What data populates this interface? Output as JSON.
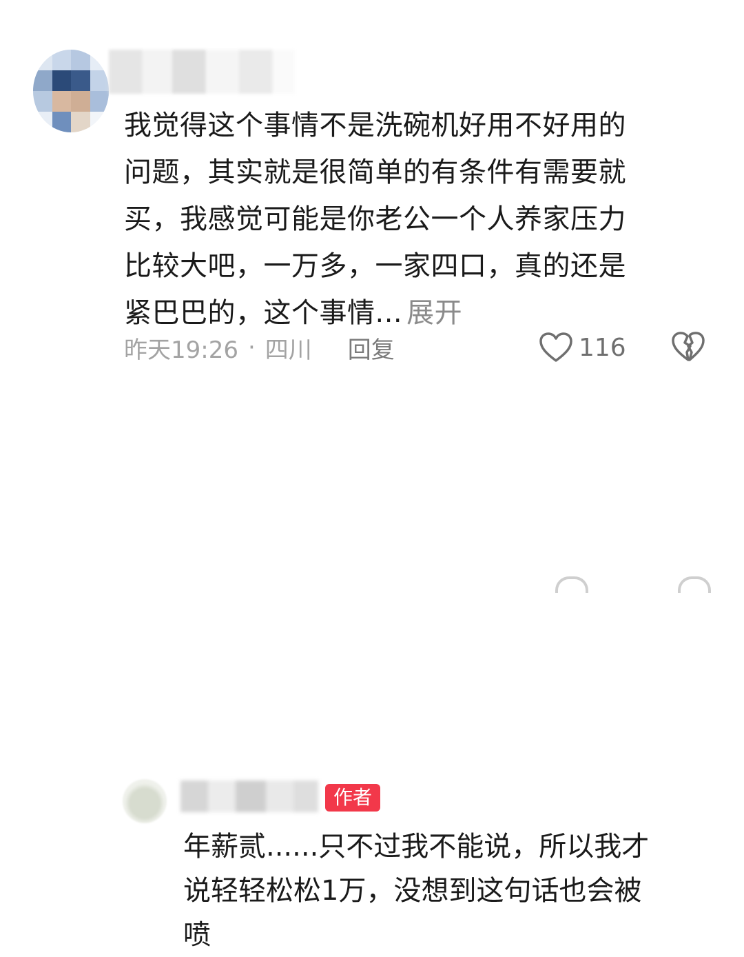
{
  "comment": {
    "lines": [
      "我觉得这个事情不是洗碗机好用不好用的",
      "问题，其实就是很简单的有条件有需要就",
      "买，我感觉可能是你老公一个人养家压力",
      "比较大吧，一万多，一家四口，真的还是",
      "紧巴巴的，这个事情..."
    ],
    "expand_label": "展开",
    "time": "昨天19:26",
    "separator": "·",
    "location": "四川",
    "reply_label": "回复",
    "like_count": "116"
  },
  "reply": {
    "badge": "作者",
    "lines": [
      "年薪贰......只不过我不能说，所以我才",
      "说轻轻松松1万，没想到这句话也会被",
      "喷"
    ]
  },
  "colors": {
    "badge_bg": "#f2384a",
    "meta_text": "#a3a3a3",
    "body_text": "#1a1a1a"
  },
  "icons": {
    "like": "heart-outline-icon",
    "dislike": "broken-heart-icon"
  }
}
